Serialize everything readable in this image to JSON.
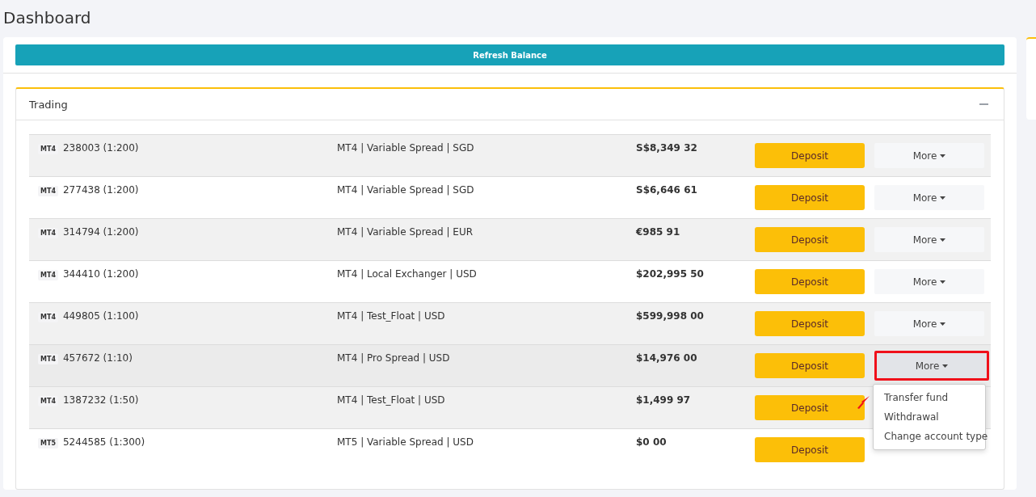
{
  "page_title": "Dashboard",
  "refresh_button": "Refresh Balance",
  "panel": {
    "title": "Trading",
    "expanded": true
  },
  "accounts": [
    {
      "platform": "MT4",
      "account": "238003 (1:200)",
      "type": "MT4 | Variable Spread | SGD",
      "balance": "S$8,349 32",
      "deposit": "Deposit",
      "more": "More",
      "menu_open": false
    },
    {
      "platform": "MT4",
      "account": "277438 (1:200)",
      "type": "MT4 | Variable Spread | SGD",
      "balance": "S$6,646 61",
      "deposit": "Deposit",
      "more": "More",
      "menu_open": false
    },
    {
      "platform": "MT4",
      "account": "314794 (1:200)",
      "type": "MT4 | Variable Spread | EUR",
      "balance": "€985 91",
      "deposit": "Deposit",
      "more": "More",
      "menu_open": false
    },
    {
      "platform": "MT4",
      "account": "344410 (1:200)",
      "type": "MT4 | Local Exchanger | USD",
      "balance": "$202,995 50",
      "deposit": "Deposit",
      "more": "More",
      "menu_open": false
    },
    {
      "platform": "MT4",
      "account": "449805 (1:100)",
      "type": "MT4 | Test_Float | USD",
      "balance": "$599,998 00",
      "deposit": "Deposit",
      "more": "More",
      "menu_open": false
    },
    {
      "platform": "MT4",
      "account": "457672 (1:10)",
      "type": "MT4 | Pro Spread | USD",
      "balance": "$14,976 00",
      "deposit": "Deposit",
      "more": "More",
      "menu_open": true,
      "menu": [
        "Transfer fund",
        "Withdrawal",
        "Change account type"
      ]
    },
    {
      "platform": "MT4",
      "account": "1387232 (1:50)",
      "type": "MT4 | Test_Float | USD",
      "balance": "$1,499 97",
      "deposit": "Deposit",
      "menu_open": false
    },
    {
      "platform": "MT5",
      "account": "5244585 (1:300)",
      "type": "MT5 | Variable Spread | USD",
      "balance": "$0 00",
      "deposit": "Deposit",
      "menu_open": false
    }
  ]
}
